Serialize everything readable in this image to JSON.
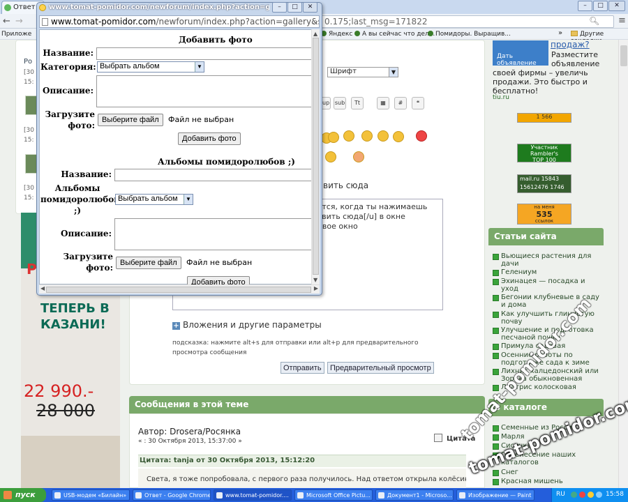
{
  "browser": {
    "tab_title": "Ответ",
    "url_tail": "0.175;last_msg=171822",
    "bookmarks": {
      "apps": "Приложе",
      "items": [
        "Яндекс",
        "А вы сейчас что дел...",
        "Помидоры. Выращив..."
      ],
      "more": "»",
      "other": "Другие закладки"
    },
    "controls": {
      "minimize": "–",
      "maximize": "□",
      "close": "✕"
    }
  },
  "popup": {
    "title": "www.tomat-pomidor.com/newforum/index.php?action=gallery&sa=post...",
    "url_host": "www.tomat-pomidor.com",
    "url_path": "/newforum/index.php?action=gallery&sa=postu",
    "form1": {
      "heading": "Добавить фото",
      "name_label": "Название:",
      "category_label": "Категория:",
      "category_value": "Выбрать альбом",
      "description_label": "Описание:",
      "upload_label": "Загрузите фото:",
      "choose_file": "Выберите файл",
      "no_file": "Файл не выбран",
      "submit": "Добавить фото"
    },
    "form2": {
      "heading": "Альбомы помидоролюбов ;)",
      "name_label": "Название:",
      "album_label": "Альбомы помидоролюбов ;)",
      "album_value": "Выбрать альбом",
      "description_label": "Описание:",
      "upload_label": "Загрузите фото:",
      "choose_file": "Выберите файл",
      "no_file": "Файл не выбран",
      "submit": "Добавить фото"
    }
  },
  "editor": {
    "font_select": "Шрифт",
    "format_buttons": [
      "sup",
      "sub",
      "Tt"
    ],
    "paste_link": "вить сюда",
    "textarea_lines": [
      "яется, когда ты нажимаешь",
      "тавить сюда[/u] в окне",
      "новое окно"
    ],
    "attach_label": "Вложения и другие параметры",
    "hint": "подсказка: нажмите alt+s для отправки или alt+p для предварительного просмотра сообщения",
    "send": "Отправить",
    "preview": "Предварительный просмотр"
  },
  "messages": {
    "header": "Сообщения в этой теме",
    "author": "Автор: Drosera/Росянка",
    "date": "« : 30 Октября 2013, 15:37:00 »",
    "quote_button": "Цитата",
    "quote_header": "Цитата: tanja от 30 Октября 2013, 15:12:20",
    "quote_text": "Света, я тоже попробовала, с первого раза получилось. Над ответом открыла колёсиком"
  },
  "left": {
    "items": [
      {
        "title": "Ро",
        "meta1": "[30",
        "meta2": "15:"
      },
      {
        "title": "",
        "meta1": "[30",
        "meta2": "15:"
      },
      {
        "title": "",
        "meta1": "[30",
        "meta2": "15:"
      }
    ],
    "banner": {
      "line1": "ТЕПЕРЬ В",
      "line2": "КАЗАНИ!",
      "price_new": "22 990.-",
      "price_old": "28 000",
      "sign": "Р"
    }
  },
  "right": {
    "ad_button": "Дать объявление",
    "ad_title": "продаж?",
    "ad_text": "Разместите объявление своей фирмы – увеличь продажи. Это быстро и бесплатно!",
    "ad_text_a": "Разместите",
    "ad_text_b": "объявление",
    "ad_text_c": "своей фирмы – увеличь продажи. Это быстро и бесплатно!",
    "ad_link": "tiu.ru",
    "counters": {
      "c1": "1 566",
      "c2a": "Участник",
      "c2b": "Rambler's",
      "c2c": "TOP 100",
      "c3a": "mail.ru 15843",
      "c3b": "15612476 1746",
      "c4a": "на меня",
      "c4b": "535",
      "c4c": "ссылок"
    },
    "articles_header": "Статьи сайта",
    "articles": [
      "Вьющиеся растения для дачи",
      "Гелениум",
      "Эхинацея — посадка и уход",
      "Бегонии клубневые в саду и дома",
      "Как улучшить глинистую почву",
      "Улучшение и подготовка песчаной почвы",
      "Примула садовая",
      "Осенние работы по подготовке сада к зиме",
      "Лихнис халцедонский или Зорька обыкновенная",
      "Лиатрис колосковая"
    ],
    "catalog_header": "В каталоге",
    "catalog": [
      "Семенные из России",
      "Марля",
      "Сисичка",
      "Перенесение наших каталогов",
      "Снег",
      "Красная мишень"
    ]
  },
  "watermark": {
    "vertical": "tomat-pomidor.com",
    "horizontal": "tomat-pomidor.com"
  },
  "taskbar": {
    "start": "пуск",
    "tasks": [
      "USB-модем «Билайн»",
      "Ответ - Google Chrome",
      "www.tomat-pomidor....",
      "Microsoft Office Pictu...",
      "Документ1 - Microso...",
      "Изображение — Paint"
    ],
    "lang": "RU",
    "time": "15:58"
  }
}
